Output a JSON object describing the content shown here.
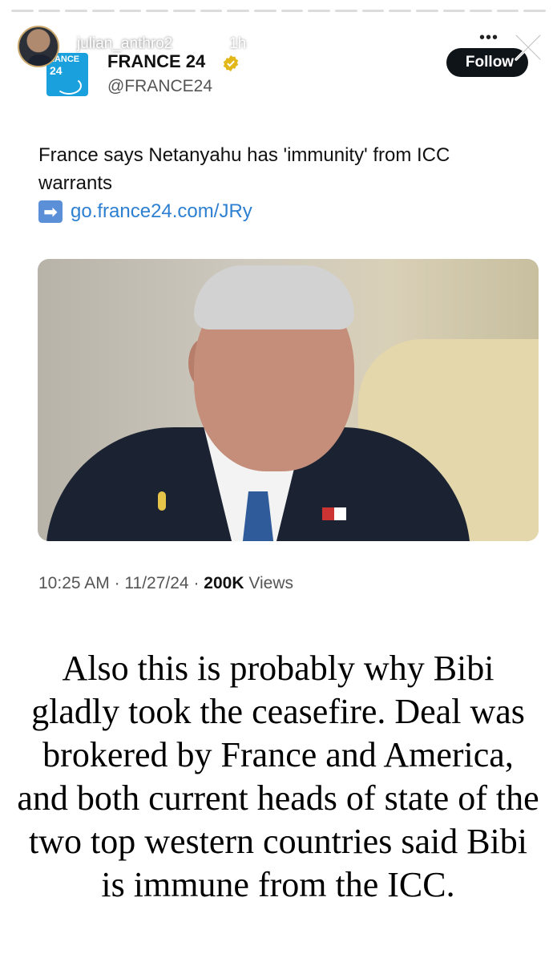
{
  "story": {
    "username": "julian_anthro2",
    "time": "1h",
    "more_icon": "more-horizontal-icon",
    "close_icon": "close-icon"
  },
  "tweet": {
    "logo_text_top": "RANCE",
    "logo_text_bottom": "24",
    "account_name": "FRANCE 24",
    "verified": true,
    "handle": "@FRANCE24",
    "follow_label": "Follow",
    "text": "France says Netanyahu has 'immunity' from ICC warrants",
    "link_arrow": "➡",
    "link": "go.france24.com/JRy",
    "time": "10:25 AM",
    "date": "11/27/24",
    "views_count": "200K",
    "views_label": "Views",
    "separator": "·"
  },
  "caption": {
    "text": "Also this is probably why Bibi gladly took the ceasefire. Deal was brokered by France and America, and both current heads of state of the two top western countries said Bibi is immune from the ICC."
  },
  "colors": {
    "follow_bg": "#0f1419",
    "link": "#2d7fd1",
    "verified": "#e2b719"
  }
}
